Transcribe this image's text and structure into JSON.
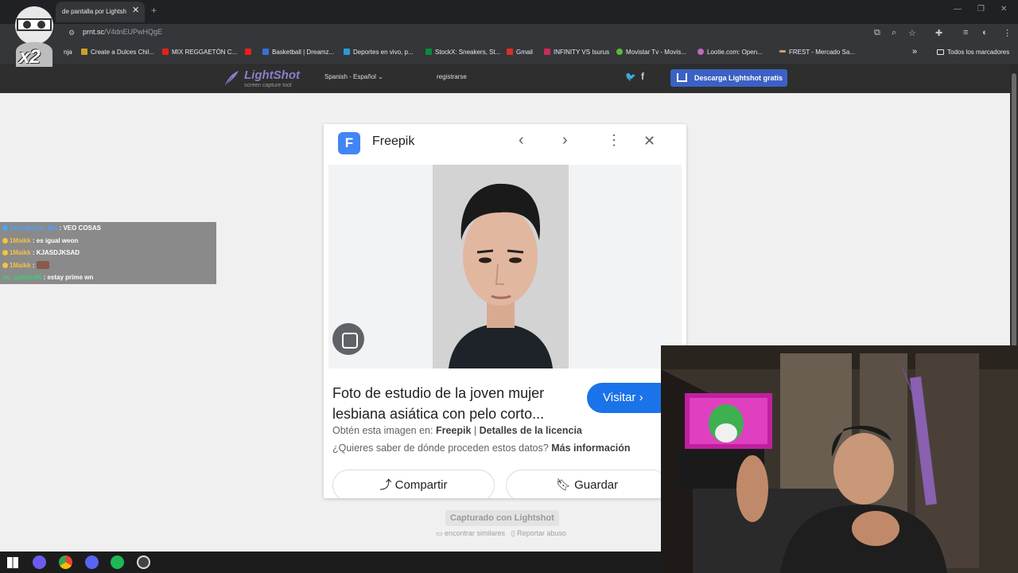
{
  "browser": {
    "tab_title": "de pantalla por Lightsh",
    "tab_close": "✕",
    "new_tab": "+",
    "address": "prnt.sc",
    "address_path": "/V4dnEUPwHQgE",
    "bookmarks": [
      {
        "label": "nja",
        "color": "#888888"
      },
      {
        "label": "Create a Dulces Chil...",
        "color": "#c9a227"
      },
      {
        "label": "MIX REGGAETÓN C...",
        "color": "#e62117"
      },
      {
        "label": "",
        "color": "#e62117"
      },
      {
        "label": "Basketball | Dreamz...",
        "color": "#3a6fd8"
      },
      {
        "label": "Deportes en vivo, p...",
        "color": "#2a9ad6"
      },
      {
        "label": "StockX: Sneakers, St...",
        "color": "#0a8a3a"
      },
      {
        "label": "Gmail",
        "color": "#d93025"
      },
      {
        "label": "INFINITY VS Isurus",
        "color": "#cc2a5a"
      },
      {
        "label": "Movistar Tv - Movis...",
        "color": "#5bbb3a"
      },
      {
        "label": "Lootie.com: Open...",
        "color": "#c06abf"
      },
      {
        "label": "FREST - Mercado Sa...",
        "color": "#d0a060"
      }
    ],
    "bookmarks_more": "»",
    "all_bookmarks": "Todos los marcadores"
  },
  "lightshot": {
    "logo": "LightShot",
    "logo_sub": "screen capture tool",
    "language": "Spanish - Español",
    "register": "registrarse",
    "download": "Descarga Lightshot gratis",
    "captured": "Capturado con Lightshot",
    "find_similar": "encontrar similares",
    "report": "Reportar abuso"
  },
  "card": {
    "source_logo": "F",
    "source_name": "Freepik",
    "title": "Foto de estudio de la joven mujer lesbiana asiática con pelo corto...",
    "visit": "Visitar",
    "get_image_prefix": "Obtén esta imagen en:",
    "get_image_source": "Freepik",
    "license": "Detalles de la licencia",
    "question": "¿Quieres saber de dónde proceden estos datos?",
    "more_info": "Más información",
    "share": "Compartir",
    "save": "Guardar"
  },
  "chat": [
    {
      "user": "Tachaluyos_Bal",
      "user_color": "#4aa3ff",
      "msg": "VEO COSAS",
      "emote": false
    },
    {
      "user": "1Maikk",
      "user_color": "#f5c242",
      "msg": "es igual weon",
      "emote": false
    },
    {
      "user": "1Maikk",
      "user_color": "#f5c242",
      "msg": "KJASDJKSAD",
      "emote": false
    },
    {
      "user": "1Maikk",
      "user_color": "#f5c242",
      "msg": "",
      "emote": true
    },
    {
      "user": "mr_gabilin96",
      "user_color": "#3ad07a",
      "msg": "estay prime wn",
      "emote": false
    }
  ],
  "overlay": {
    "multiplier": "x2"
  }
}
